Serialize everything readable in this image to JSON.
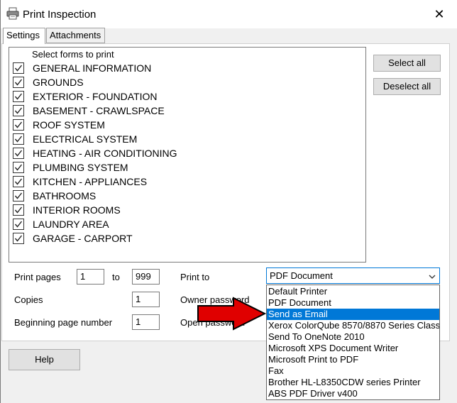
{
  "window": {
    "title": "Print Inspection",
    "close_glyph": "✕",
    "icon": "printer-icon"
  },
  "tabs": [
    {
      "label": "Settings",
      "active": true
    },
    {
      "label": "Attachments",
      "active": false
    }
  ],
  "forms": {
    "header": "Select forms to print",
    "items": [
      {
        "label": "GENERAL INFORMATION",
        "checked": true
      },
      {
        "label": "GROUNDS",
        "checked": true
      },
      {
        "label": "EXTERIOR - FOUNDATION",
        "checked": true
      },
      {
        "label": "BASEMENT - CRAWLSPACE",
        "checked": true
      },
      {
        "label": "ROOF SYSTEM",
        "checked": true
      },
      {
        "label": "ELECTRICAL SYSTEM",
        "checked": true
      },
      {
        "label": "HEATING - AIR CONDITIONING",
        "checked": true
      },
      {
        "label": "PLUMBING SYSTEM",
        "checked": true
      },
      {
        "label": "KITCHEN - APPLIANCES",
        "checked": true
      },
      {
        "label": "BATHROOMS",
        "checked": true
      },
      {
        "label": "INTERIOR ROOMS",
        "checked": true
      },
      {
        "label": "LAUNDRY AREA",
        "checked": true
      },
      {
        "label": "GARAGE - CARPORT",
        "checked": true
      }
    ]
  },
  "buttons": {
    "select_all": "Select all",
    "deselect_all": "Deselect all",
    "help": "Help"
  },
  "options": {
    "print_pages_label": "Print pages",
    "pages_from": "1",
    "to_label": "to",
    "pages_to": "999",
    "copies_label": "Copies",
    "copies": "1",
    "begin_page_label": "Beginning page number",
    "begin_page": "1",
    "print_to_label": "Print to",
    "owner_password_label": "Owner password",
    "open_password_label": "Open password"
  },
  "printer": {
    "selected": "PDF Document",
    "highlighted_index": 2,
    "options": [
      "Default Printer",
      "PDF Document",
      "Send as Email",
      "Xerox ColorQube 8570/8870 Series Class",
      "Send To OneNote 2010",
      "Microsoft XPS Document Writer",
      "Microsoft Print to PDF",
      "Fax",
      "Brother HL-L8350CDW series Printer",
      "ABS PDF Driver v400"
    ]
  },
  "annotation": {
    "arrow_color": "#e00000",
    "arrow_icon": "red-arrow-icon"
  },
  "colors": {
    "accent": "#0078d7"
  }
}
